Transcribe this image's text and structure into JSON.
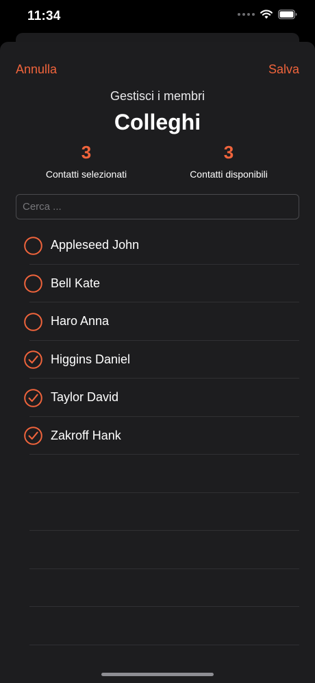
{
  "status_bar": {
    "time": "11:34"
  },
  "nav": {
    "cancel_label": "Annulla",
    "save_label": "Salva"
  },
  "header": {
    "subtitle": "Gestisci i membri",
    "title": "Colleghi"
  },
  "stats": {
    "selected_count": "3",
    "selected_label": "Contatti selezionati",
    "available_count": "3",
    "available_label": "Contatti disponibili"
  },
  "search": {
    "placeholder": "Cerca ...",
    "value": ""
  },
  "contacts": [
    {
      "name": "Appleseed John",
      "selected": false
    },
    {
      "name": "Bell Kate",
      "selected": false
    },
    {
      "name": "Haro Anna",
      "selected": false
    },
    {
      "name": "Higgins Daniel",
      "selected": true
    },
    {
      "name": "Taylor David",
      "selected": true
    },
    {
      "name": "Zakroff Hank",
      "selected": true
    }
  ],
  "colors": {
    "accent": "#f0643c",
    "sheet_background": "#1d1d1f",
    "separator": "#303033"
  },
  "icons": {
    "unchecked": "circle-icon",
    "checked": "checkmark-circle-icon"
  }
}
